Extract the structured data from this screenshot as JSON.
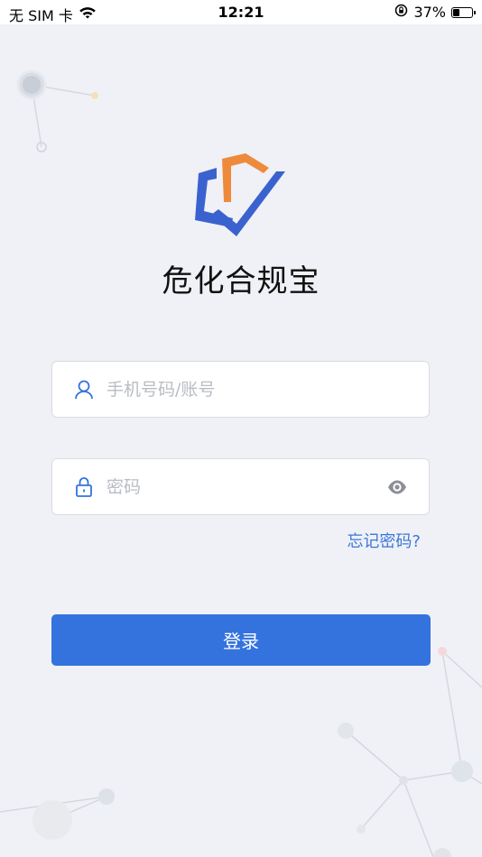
{
  "status_bar": {
    "carrier": "无 SIM 卡",
    "time": "12:21",
    "battery_percent": "37%",
    "battery_level": 0.37
  },
  "app": {
    "title": "危化合规宝"
  },
  "login": {
    "account_placeholder": "手机号码/账号",
    "password_placeholder": "密码",
    "forgot_label": "忘记密码?",
    "submit_label": "登录"
  },
  "icons": {
    "wifi": "wifi-icon",
    "rotation_lock": "rotation-lock-icon",
    "battery": "battery-icon",
    "user": "user-icon",
    "lock": "lock-icon",
    "eye": "eye-icon",
    "logo": "app-logo"
  },
  "colors": {
    "background": "#f0f1f6",
    "primary": "#3473de",
    "link": "#3a78d8",
    "logo_orange": "#ee8a3c",
    "logo_blue": "#3a62cf"
  }
}
